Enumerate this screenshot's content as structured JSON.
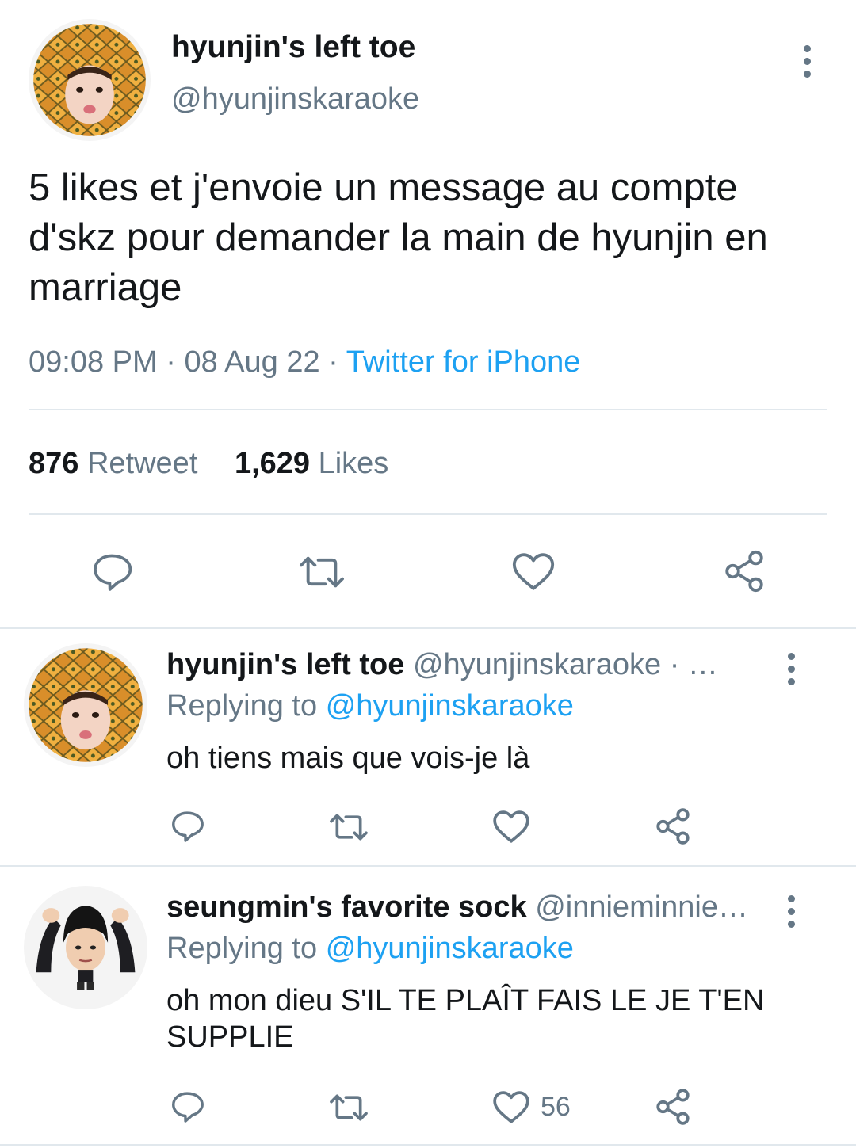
{
  "main_tweet": {
    "display_name": "hyunjin's left toe",
    "handle": "@hyunjinskaraoke",
    "text": "5 likes et j'envoie un message au compte d'skz pour demander la main de hyunjin en marriage",
    "time": "09:08 PM",
    "date": "08 Aug 22",
    "separator": "·",
    "source": "Twitter for iPhone",
    "retweet_count": "876",
    "retweet_label": "Retweet",
    "like_count": "1,629",
    "like_label": "Likes"
  },
  "replies": [
    {
      "display_name": "hyunjin's left toe",
      "handle_line": "@hyunjinskaraoke · …",
      "replying_label": "Replying to",
      "replying_to": "@hyunjinskaraoke",
      "text": "oh tiens mais que vois-je là",
      "like_count": ""
    },
    {
      "display_name": "seungmin's favorite sock",
      "handle_line": "@innieminnie…",
      "replying_label": "Replying to",
      "replying_to": "@hyunjinskaraoke",
      "text": "oh mon dieu S'IL TE PLAÎT FAIS LE JE T'EN SUPPLIE",
      "like_count": "56"
    }
  ],
  "icons": {
    "more": "more-vertical-icon",
    "reply": "reply-bubble-icon",
    "retweet": "retweet-icon",
    "like": "heart-icon",
    "share": "share-icon"
  },
  "colors": {
    "accent": "#1da1f2",
    "secondary_text": "#657786",
    "primary_text": "#14171a",
    "divider": "#e1e8ed"
  }
}
